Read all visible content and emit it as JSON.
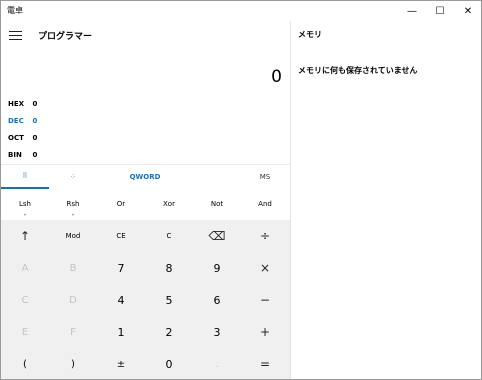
{
  "window": {
    "title": "電卓",
    "minimize": "—",
    "maximize": "☐",
    "close": "✕"
  },
  "calc": {
    "mode_title": "プログラマー",
    "display": "0",
    "radix": [
      {
        "name": "HEX",
        "value": "0",
        "active": false
      },
      {
        "name": "DEC",
        "value": "0",
        "active": true
      },
      {
        "name": "OCT",
        "value": "0",
        "active": false
      },
      {
        "name": "BIN",
        "value": "0",
        "active": false
      }
    ],
    "tabs": {
      "keypad_icon": "⠿",
      "bitflip_icon": "⁘",
      "word_size": "QWORD",
      "ms": "MS"
    },
    "bitops": [
      "Lsh",
      "Rsh",
      "Or",
      "Xor",
      "Not",
      "And"
    ],
    "bitop_dot": "•",
    "keys": [
      [
        "↑",
        "Mod",
        "CE",
        "C",
        "⌫",
        "÷"
      ],
      [
        "A",
        "B",
        "7",
        "8",
        "9",
        "×"
      ],
      [
        "C",
        "D",
        "4",
        "5",
        "6",
        "−"
      ],
      [
        "E",
        "F",
        "1",
        "2",
        "3",
        "+"
      ],
      [
        "(",
        ")",
        "±",
        "0",
        ".",
        "="
      ]
    ]
  },
  "memory": {
    "title": "メモリ",
    "empty_message": "メモリに何も保存されていません"
  },
  "colors": {
    "accent": "#1a6fb8",
    "keypad_bg": "#f0f0f0",
    "disabled_text": "#c4c4c4"
  }
}
